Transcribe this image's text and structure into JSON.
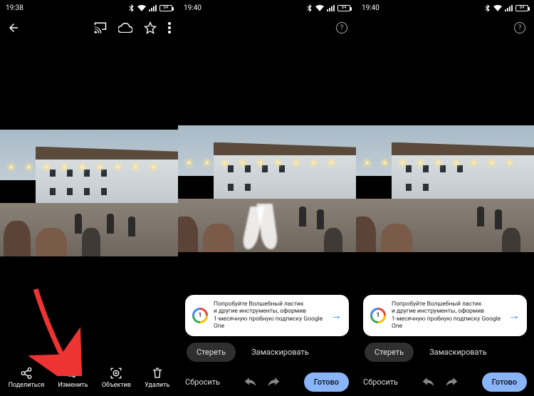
{
  "panel1": {
    "status": {
      "time": "19:38",
      "battery": "84"
    },
    "actions": {
      "share": "Поделиться",
      "edit": "Изменить",
      "lens": "Объектив",
      "delete": "Удалить"
    }
  },
  "panel2": {
    "status": {
      "time": "19:40",
      "battery": "84"
    },
    "promo": {
      "line1": "Попробуйте Волшебный ластик",
      "line2": "и другие инструменты, оформив",
      "line3": "1-месячную пробную подписку Google",
      "line4": "One"
    },
    "chips": {
      "erase": "Стереть",
      "mask": "Замаскировать"
    },
    "editbar": {
      "reset": "Сбросить",
      "done": "Готово"
    }
  },
  "panel3": {
    "status": {
      "time": "19:40",
      "battery": "84"
    },
    "promo": {
      "line1": "Попробуйте Волшебный ластик",
      "line2": "и другие инструменты, оформив",
      "line3": "1-месячную пробную подписку Google",
      "line4": "One"
    },
    "chips": {
      "erase": "Стереть",
      "mask": "Замаскировать"
    },
    "editbar": {
      "reset": "Сбросить",
      "done": "Готово"
    }
  },
  "icons": {
    "g1_digit": "1",
    "help": "?"
  }
}
